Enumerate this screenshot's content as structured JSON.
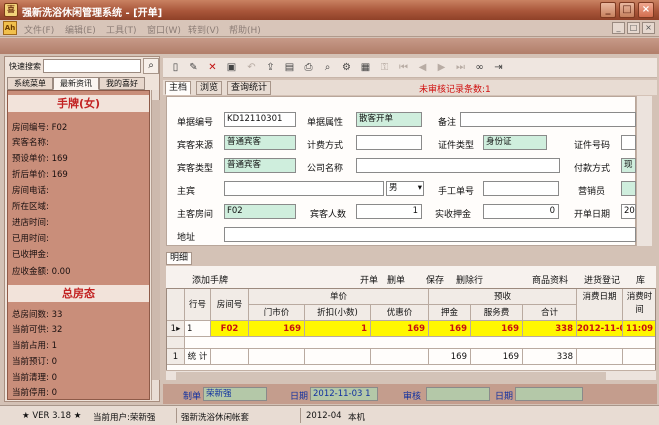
{
  "window": {
    "title": "强新洗浴休闲管理系统 - [开单]",
    "minimize": "_",
    "maximize": "□",
    "close": "×",
    "app_icon": "喜"
  },
  "menu": {
    "logo": "Ah",
    "items": [
      "文件(F)",
      "编辑(E)",
      "工具(T)",
      "窗口(W)",
      "转到(V)",
      "帮助(H)"
    ],
    "mdi_buttons": [
      "_",
      "□",
      "×"
    ]
  },
  "left_panel": {
    "search_label": "快速搜索",
    "search_value": "",
    "search_icon": "magnifier-icon",
    "tabs": [
      "系统菜单",
      "最新资讯",
      "我的喜好"
    ],
    "active_tab": 1,
    "room_title": "手牌(女)",
    "room_fields": [
      "房间编号: F02",
      "宾客名称:",
      "预设单价: 169",
      "折后单价: 169",
      "房间电话:",
      "所在区域:",
      "进店时间:",
      "已用时间:",
      "已收押金:",
      "应收金额: 0.00"
    ],
    "summary_title": "总房态",
    "summary_fields": [
      "总房间数: 33",
      "当前可供: 32",
      "当前占用: 1",
      "当前预订: 0",
      "当前清理: 0",
      "当前停用: 0"
    ]
  },
  "toolbar": {
    "icons": [
      "new-icon",
      "edit-icon",
      "delete-icon",
      "save-icon",
      "undo-icon",
      "export-icon",
      "print-preview-icon",
      "print-icon",
      "search-icon",
      "settings-icon",
      "chart-icon",
      "lock-icon",
      "first-icon",
      "prev-icon",
      "next-icon",
      "last-icon",
      "link-icon",
      "exit-icon"
    ]
  },
  "tabs": [
    "主档",
    "浏览",
    "查询统计"
  ],
  "active_tab": 0,
  "unreviewed_count": "未审核记录条数:1",
  "form": {
    "doc_no_label": "单据编号",
    "doc_no": "KD12110301",
    "doc_attr_label": "单据属性",
    "doc_attr": "散客开单",
    "remark_label": "备注",
    "remark": "",
    "guest_source_label": "宾客来源",
    "guest_source": "普通宾客",
    "billing_label": "计费方式",
    "billing": "",
    "id_type_label": "证件类型",
    "id_type": "身份证",
    "id_no_label": "证件号码",
    "id_no": "",
    "guest_type_label": "宾客类型",
    "guest_type": "普通宾客",
    "company_label": "公司名称",
    "company": "",
    "payment_label": "付款方式",
    "payment": "现",
    "host_label": "主宾",
    "host": "",
    "gender": "男",
    "manual_no_label": "手工单号",
    "manual_no": "",
    "sales_label": "营销员",
    "sales": "",
    "main_room_label": "主客房间",
    "main_room": "F02",
    "guest_count_label": "宾客人数",
    "guest_count": "1",
    "deposit_label": "实收押金",
    "deposit": "0",
    "open_date_label": "开单日期",
    "open_date": "20",
    "address_label": "地址",
    "address": ""
  },
  "detail": {
    "section_tab": "明细",
    "actions": [
      "添加手牌",
      "开单",
      "删单",
      "保存",
      "删除行",
      "商品资料",
      "进货登记",
      "库"
    ],
    "headers": {
      "row_no": "行号",
      "room_no": "房间号",
      "unit_price": "单价",
      "door_price": "门市价",
      "discount": "折扣(小数)",
      "special_price": "优惠价",
      "prepay": "预收",
      "deposit": "押金",
      "service_fee": "服务费",
      "total": "合计",
      "consume_date": "消费日期",
      "consume_time": "消费时间"
    },
    "rows": [
      {
        "indicator": "1▸",
        "row_no": "1",
        "room_no": "F02",
        "door_price": "169",
        "discount": "1",
        "special_price": "169",
        "deposit": "169",
        "service_fee": "169",
        "total": "338",
        "consume_date": "2012-11-0",
        "consume_time": "11:09"
      }
    ],
    "totals": {
      "row_no": "1",
      "label": "统 计",
      "deposit": "169",
      "service_fee": "169",
      "total": "338"
    }
  },
  "footer": {
    "maker_label": "制单",
    "maker": "荣新强",
    "date_label": "日期",
    "date": "2012-11-03 1",
    "review_label": "审核",
    "reviewer": "",
    "review_date_label": "日期",
    "review_date": ""
  },
  "status": {
    "version": "★ VER 3.18 ★",
    "user": "当前用户:荣新强",
    "account": "强新洗浴休闲帐套",
    "period": "2012-04",
    "machine": "本机"
  }
}
